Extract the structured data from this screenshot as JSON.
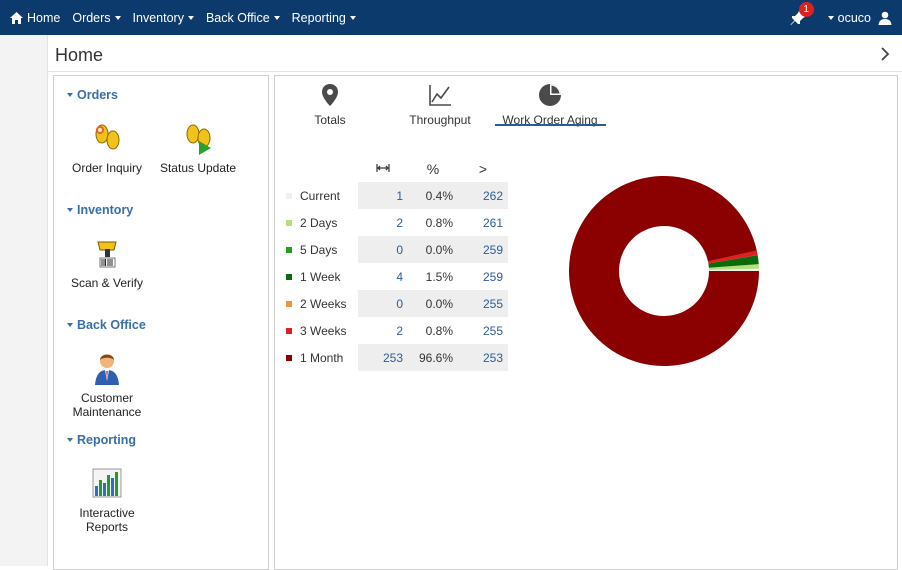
{
  "navbar": {
    "items": [
      {
        "label": "Home",
        "icon": "home-icon"
      },
      {
        "label": "Orders",
        "dropdown": true
      },
      {
        "label": "Inventory",
        "dropdown": true
      },
      {
        "label": "Back Office",
        "dropdown": true
      },
      {
        "label": "Reporting",
        "dropdown": true
      }
    ],
    "notification_count": "1",
    "username": "ocuco",
    "bg_color": "#0d3a6d",
    "badge_color": "#e0201c"
  },
  "page": {
    "title": "Home"
  },
  "launcher": {
    "sections": [
      {
        "title": "Orders",
        "tiles": [
          {
            "label": "Order Inquiry",
            "icon": "order-inquiry-icon"
          },
          {
            "label": "Status Update",
            "icon": "status-update-icon"
          }
        ]
      },
      {
        "title": "Inventory",
        "tiles": [
          {
            "label": "Scan & Verify",
            "icon": "barcode-scanner-icon"
          }
        ]
      },
      {
        "title": "Back Office",
        "tiles": [
          {
            "label": "Customer Maintenance",
            "icon": "customer-icon"
          }
        ]
      },
      {
        "title": "Reporting",
        "tiles": [
          {
            "label": "Interactive Reports",
            "icon": "report-chart-icon"
          }
        ]
      }
    ]
  },
  "tabs": [
    {
      "label": "Totals",
      "icon": "map-pin-icon"
    },
    {
      "label": "Throughput",
      "icon": "line-chart-icon"
    },
    {
      "label": "Work Order Aging",
      "icon": "pie-chart-icon",
      "active": true
    }
  ],
  "aging_table": {
    "headers": [
      "↔",
      "%",
      ">"
    ],
    "rows": [
      {
        "name": "Current",
        "count": "1",
        "percent": "0.4%",
        "over": "262",
        "color": "#f0f0f0"
      },
      {
        "name": "2 Days",
        "count": "2",
        "percent": "0.8%",
        "over": "261",
        "color": "#b3e07a"
      },
      {
        "name": "5 Days",
        "count": "0",
        "percent": "0.0%",
        "over": "259",
        "color": "#1fa31f"
      },
      {
        "name": "1 Week",
        "count": "4",
        "percent": "1.5%",
        "over": "259",
        "color": "#0a6b0a"
      },
      {
        "name": "2 Weeks",
        "count": "0",
        "percent": "0.0%",
        "over": "255",
        "color": "#f0943a"
      },
      {
        "name": "3 Weeks",
        "count": "2",
        "percent": "0.8%",
        "over": "255",
        "color": "#e02020"
      },
      {
        "name": "1 Month",
        "count": "253",
        "percent": "96.6%",
        "over": "253",
        "color": "#8b0000"
      }
    ]
  },
  "chart_data": {
    "type": "pie",
    "donut": true,
    "categories": [
      "Current",
      "2 Days",
      "5 Days",
      "1 Week",
      "2 Weeks",
      "3 Weeks",
      "1 Month"
    ],
    "values": [
      1,
      2,
      0,
      4,
      0,
      2,
      253
    ],
    "colors": [
      "#f0f0f0",
      "#b3e07a",
      "#1fa31f",
      "#0a6b0a",
      "#f0943a",
      "#e02020",
      "#8b0000"
    ]
  }
}
